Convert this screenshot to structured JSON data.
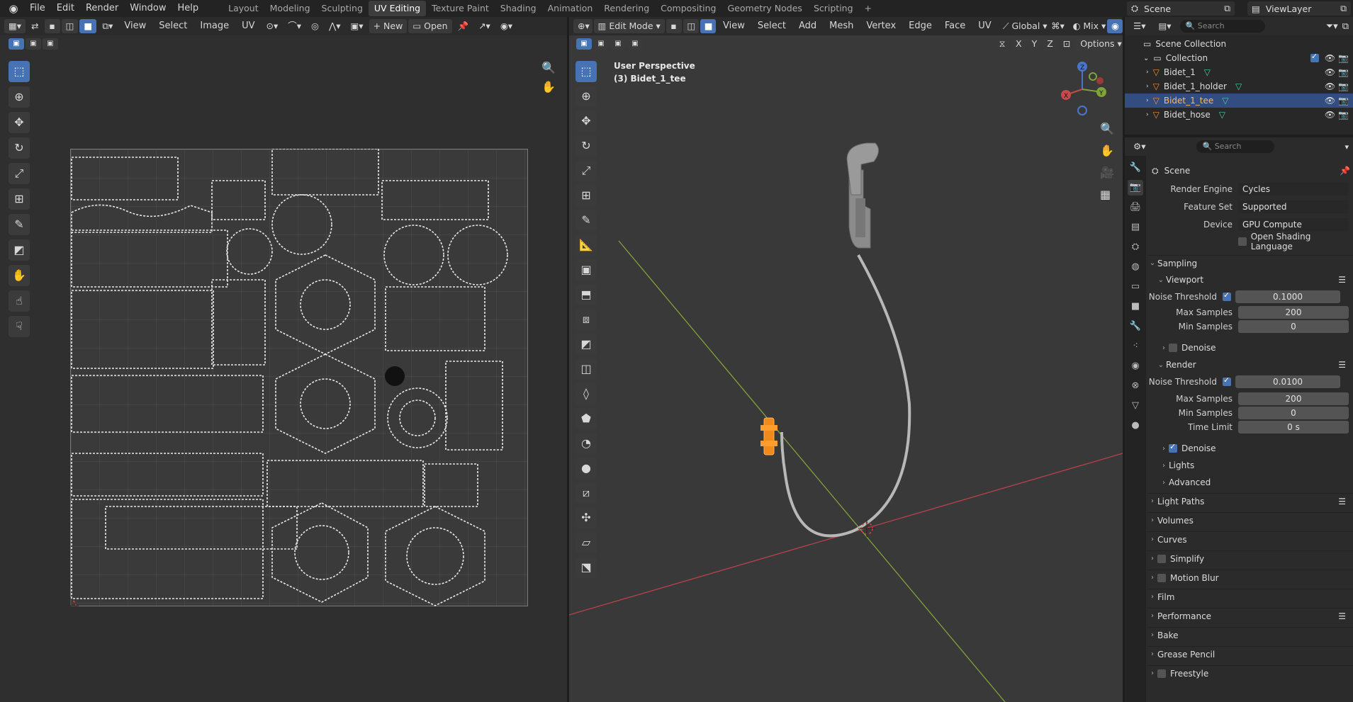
{
  "menu": [
    "File",
    "Edit",
    "Render",
    "Window",
    "Help"
  ],
  "workspaces": [
    "Layout",
    "Modeling",
    "Sculpting",
    "UV Editing",
    "Texture Paint",
    "Shading",
    "Animation",
    "Rendering",
    "Compositing",
    "Geometry Nodes",
    "Scripting"
  ],
  "workspace_add": "+",
  "scene_name": "Scene",
  "view_layer": "ViewLayer",
  "uv_editor": {
    "menus": [
      "View",
      "Select",
      "Image",
      "UV"
    ],
    "new_label": "New",
    "open_label": "Open"
  },
  "viewport": {
    "mode": "Edit Mode",
    "menus": [
      "View",
      "Select",
      "Add",
      "Mesh",
      "Vertex",
      "Edge",
      "Face",
      "UV"
    ],
    "transform_orientation": "Global",
    "shading_mix": "Mix",
    "options_label": "Options",
    "axis_x": "X",
    "axis_y": "Y",
    "axis_z": "Z",
    "perspective_label": "User Perspective",
    "object_label": "(3) Bidet_1_tee",
    "colors": {
      "x_axis": "#b8424a",
      "y_axis": "#7fa23a",
      "selected": "#f08a1c"
    }
  },
  "outliner": {
    "search_placeholder": "Search",
    "scene_collection": "Scene Collection",
    "collection": "Collection",
    "objects": [
      "Bidet_1",
      "Bidet_1_holder",
      "Bidet_1_tee",
      "Bidet_hose"
    ],
    "selected": "Bidet_1_tee"
  },
  "properties": {
    "search_placeholder": "Search",
    "context_title": "Scene",
    "render_engine_label": "Render Engine",
    "render_engine": "Cycles",
    "feature_set_label": "Feature Set",
    "feature_set": "Supported",
    "device_label": "Device",
    "device": "GPU Compute",
    "osl_label": "Open Shading Language",
    "sampling": "Sampling",
    "viewport": {
      "title": "Viewport",
      "noise_threshold_label": "Noise Threshold",
      "noise_threshold": "0.1000",
      "max_samples_label": "Max Samples",
      "max_samples": "200",
      "min_samples_label": "Min Samples",
      "min_samples": "0",
      "denoise_label": "Denoise"
    },
    "render": {
      "title": "Render",
      "noise_threshold_label": "Noise Threshold",
      "noise_threshold": "0.0100",
      "max_samples_label": "Max Samples",
      "max_samples": "200",
      "min_samples_label": "Min Samples",
      "min_samples": "0",
      "time_limit_label": "Time Limit",
      "time_limit": "0 s",
      "denoise_label": "Denoise"
    },
    "lights": "Lights",
    "advanced": "Advanced",
    "light_paths": "Light Paths",
    "volumes": "Volumes",
    "curves": "Curves",
    "simplify": "Simplify",
    "motion_blur": "Motion Blur",
    "film": "Film",
    "performance": "Performance",
    "bake": "Bake",
    "grease_pencil": "Grease Pencil",
    "freestyle": "Freestyle"
  }
}
